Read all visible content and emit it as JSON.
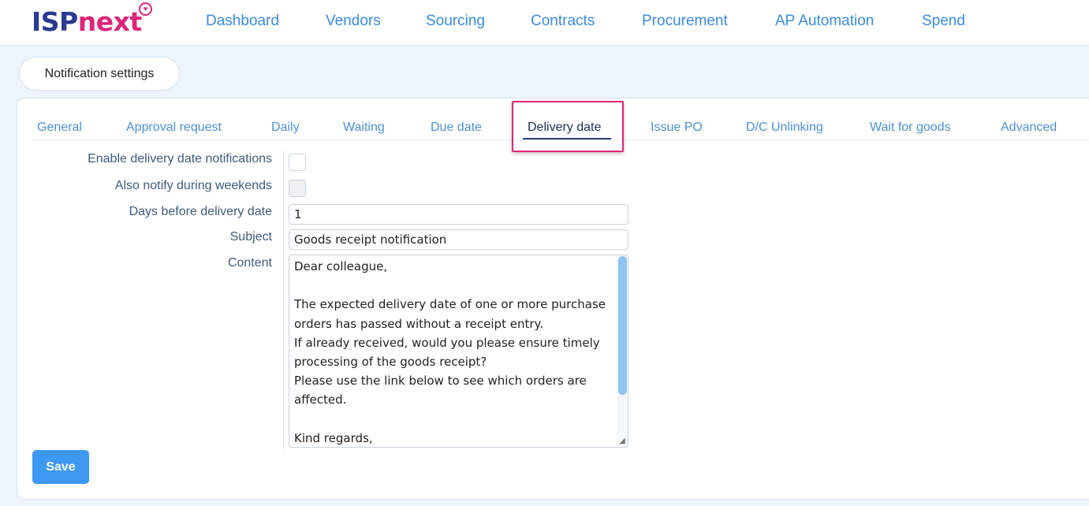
{
  "brand": {
    "logo_left": "ISP",
    "logo_right": "next",
    "badge_icon": "heart-badge-icon"
  },
  "nav": {
    "items": [
      {
        "label": "Dashboard"
      },
      {
        "label": "Vendors"
      },
      {
        "label": "Sourcing"
      },
      {
        "label": "Contracts"
      },
      {
        "label": "Procurement"
      },
      {
        "label": "AP Automation"
      },
      {
        "label": "Spend"
      }
    ]
  },
  "breadcrumb": {
    "label": "Notification settings"
  },
  "tabs": {
    "items": [
      {
        "label": "General"
      },
      {
        "label": "Approval request"
      },
      {
        "label": "Daily"
      },
      {
        "label": "Waiting"
      },
      {
        "label": "Due date"
      },
      {
        "label": "Delivery date"
      },
      {
        "label": "Issue PO"
      },
      {
        "label": "D/C Unlinking"
      },
      {
        "label": "Wait for goods"
      },
      {
        "label": "Advanced"
      }
    ],
    "active": "Delivery date"
  },
  "form": {
    "enable_label": "Enable delivery date notifications",
    "enable_checked": false,
    "weekends_label": "Also notify during weekends",
    "weekends_checked": false,
    "days_label": "Days before delivery date",
    "days_value": "1",
    "subject_label": "Subject",
    "subject_value": "Goods receipt notification",
    "content_label": "Content",
    "content_value": "Dear colleague,\n\nThe expected delivery date of one or more purchase orders has passed without a receipt entry.\nIf already received, would you please ensure timely processing of the goods receipt?\nPlease use the link below to see which orders are affected.\n\nKind regards,"
  },
  "actions": {
    "save_label": "Save"
  },
  "colors": {
    "brand_dark": "#2b3a8f",
    "brand_accent": "#e0247a",
    "link": "#3b8be0",
    "save_button": "#3d98f2",
    "highlight": "#e0287a"
  }
}
